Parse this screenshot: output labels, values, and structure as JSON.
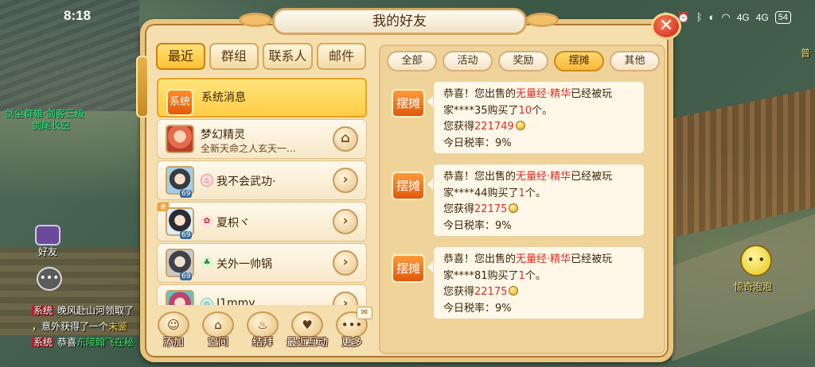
{
  "status_bar": {
    "time": "8:18",
    "icons": [
      "nfc-icon",
      "alarm-icon",
      "bluetooth-icon",
      "dnd-icon",
      "wifi-icon",
      "signal-icon",
      "signal-icon"
    ],
    "signal_1": "4G",
    "signal_2": "4G",
    "battery": "54"
  },
  "background": {
    "guild_label": "剑尘群雄·剑客三级",
    "player_name": "剑尾长空",
    "friend_shortcut": "好友",
    "top_right_text": "普",
    "emote_label": "惊奇泡泡",
    "chat": [
      {
        "tag": "系统",
        "parts": [
          {
            "t": "晚风赴山河领取了",
            "c": "white"
          }
        ]
      },
      {
        "tag": "",
        "parts": [
          {
            "t": "，意外获得了一个",
            "c": "white"
          },
          {
            "t": "未鉴",
            "c": "yellow"
          }
        ]
      },
      {
        "tag": "系统",
        "parts": [
          {
            "t": "恭喜",
            "c": "white"
          },
          {
            "t": "东陵翰飞在秘",
            "c": "green"
          }
        ]
      }
    ]
  },
  "dialog": {
    "title": "我的好友",
    "close_label": "✕",
    "tabs": [
      {
        "label": "最近",
        "active": true
      },
      {
        "label": "群组",
        "active": false
      },
      {
        "label": "联系人",
        "active": false
      },
      {
        "label": "邮件",
        "active": false
      }
    ],
    "list": {
      "system": {
        "badge": "系统",
        "title": "系统消息"
      },
      "spirit": {
        "name": "梦幻精灵",
        "sub": "全新天命之人玄天一..."
      },
      "friends": [
        {
          "name": "我不会武功·",
          "level": "69",
          "school": "♨"
        },
        {
          "name": "夏枳ヾ",
          "level": "69",
          "school": "✿",
          "ribbon": "亲"
        },
        {
          "name": "关外一帅锅",
          "level": "69",
          "school": "♣"
        },
        {
          "name": "J1mmy",
          "level": "",
          "school": "◎"
        }
      ]
    },
    "bottom_actions": [
      {
        "label": "添加",
        "icon": "add-friend-icon"
      },
      {
        "label": "空间",
        "icon": "house-icon"
      },
      {
        "label": "结拜",
        "icon": "pot-icon"
      },
      {
        "label": "最近互动",
        "icon": "couple-icon"
      },
      {
        "label": "更多",
        "icon": "more-icon"
      }
    ],
    "filters": [
      {
        "label": "全部",
        "active": false
      },
      {
        "label": "活动",
        "active": false
      },
      {
        "label": "奖励",
        "active": false
      },
      {
        "label": "摆摊",
        "active": true
      },
      {
        "label": "其他",
        "active": false
      }
    ],
    "messages": [
      {
        "tag": "摆摊",
        "l1_a": "恭喜！您出售的",
        "item": "无量经·精华",
        "l1_b": "已经被玩",
        "l2_a": "家****35购买了",
        "qty": "10",
        "l2_b": "个。",
        "l3_a": "您获得",
        "amount": "221749",
        "tax": "今日税率：9%"
      },
      {
        "tag": "摆摊",
        "l1_a": "恭喜！您出售的",
        "item": "无量经·精华",
        "l1_b": "已经被玩",
        "l2_a": "家****44购买了",
        "qty": "1",
        "l2_b": "个。",
        "l3_a": "您获得",
        "amount": "22175",
        "tax": "今日税率：9%"
      },
      {
        "tag": "摆摊",
        "l1_a": "恭喜！您出售的",
        "item": "无量经·精华",
        "l1_b": "已经被玩",
        "l2_a": "家****81购买了",
        "qty": "1",
        "l2_b": "个。",
        "l3_a": "您获得",
        "amount": "22175",
        "tax": "今日税率：9%"
      }
    ]
  },
  "colors": {
    "accent": "#ffc032",
    "highlight_text": "#e02a22",
    "panel": "#f6dfae"
  }
}
